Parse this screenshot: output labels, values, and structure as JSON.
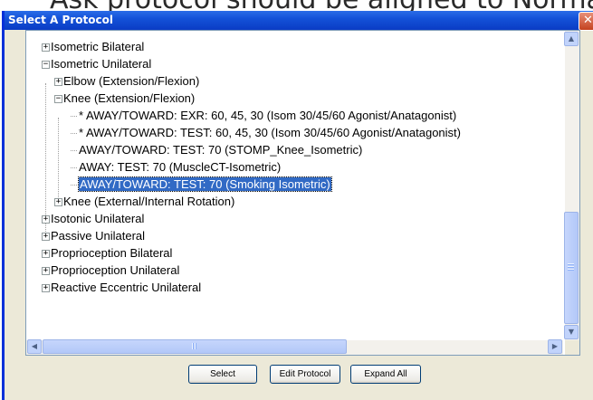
{
  "background": {
    "text": "Ask protocol should be aligned to Normal"
  },
  "dialog": {
    "title": "Select A Protocol",
    "close_symbol": "✕"
  },
  "tree": {
    "items": [
      {
        "label": "Isometric Bilateral",
        "level": 0,
        "expanded": false
      },
      {
        "label": "Isometric Unilateral",
        "level": 0,
        "expanded": true
      },
      {
        "label": "Elbow (Extension/Flexion)",
        "level": 1,
        "expanded": false
      },
      {
        "label": "Knee (Extension/Flexion)",
        "level": 1,
        "expanded": true
      },
      {
        "label": "* AWAY/TOWARD: EXR: 60, 45, 30 (Isom 30/45/60 Agonist/Anatagonist)",
        "level": 2
      },
      {
        "label": "* AWAY/TOWARD: TEST: 60, 45, 30 (Isom 30/45/60 Agonist/Anatagonist)",
        "level": 2
      },
      {
        "label": "AWAY/TOWARD: TEST: 70 (STOMP_Knee_Isometric)",
        "level": 2
      },
      {
        "label": "AWAY: TEST: 70 (MuscleCT-Isometric)",
        "level": 2
      },
      {
        "label": "AWAY/TOWARD: TEST: 70 (Smoking Isometric)",
        "level": 2,
        "selected": true
      },
      {
        "label": "Knee (External/Internal Rotation)",
        "level": 1,
        "expanded": false
      },
      {
        "label": "Isotonic Unilateral",
        "level": 0,
        "expanded": false
      },
      {
        "label": "Passive Unilateral",
        "level": 0,
        "expanded": false
      },
      {
        "label": "Proprioception Bilateral",
        "level": 0,
        "expanded": false
      },
      {
        "label": "Proprioception Unilateral",
        "level": 0,
        "expanded": false
      },
      {
        "label": "Reactive Eccentric Unilateral",
        "level": 0,
        "expanded": false
      }
    ]
  },
  "buttons": {
    "select": "Select",
    "edit_protocol": "Edit Protocol",
    "expand_all": "Expand All"
  },
  "colors": {
    "titlebar": "#0A3CC5",
    "selection": "#316AC5",
    "dialog_bg": "#ECE9D8"
  }
}
